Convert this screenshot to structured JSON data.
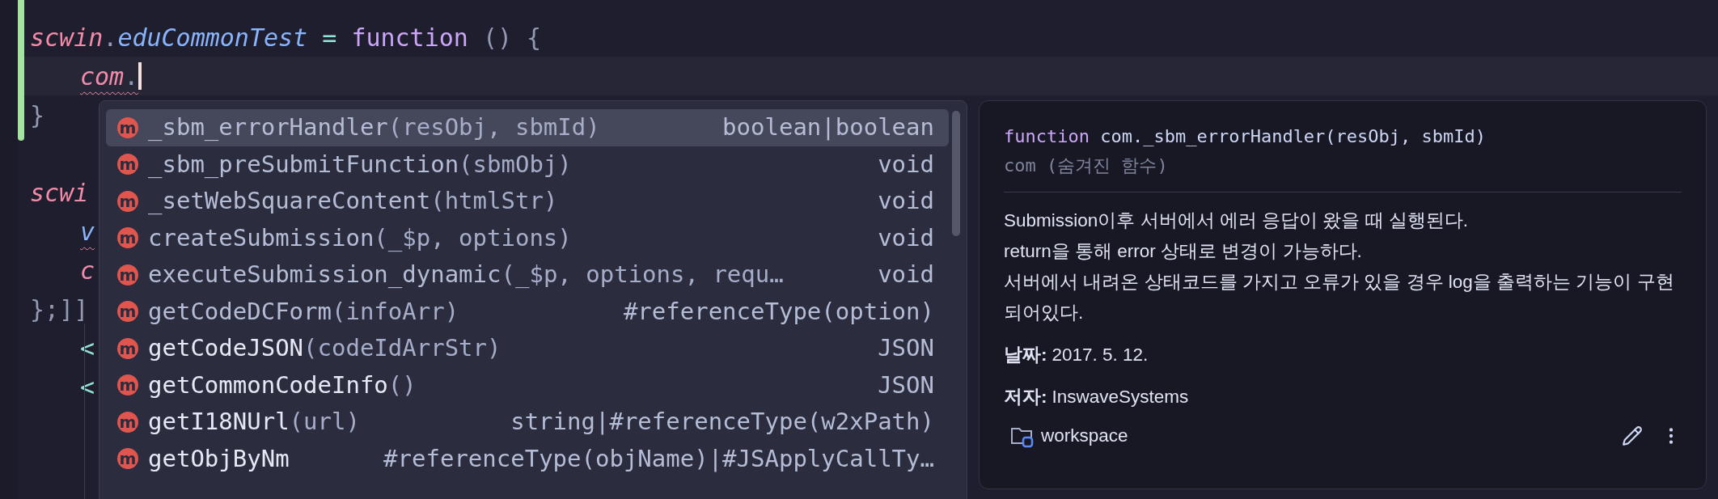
{
  "editor": {
    "lines": [
      {
        "tokens": [
          {
            "text": "scwin",
            "kind": "object"
          },
          {
            "text": ".",
            "kind": "punct"
          },
          {
            "text": "eduCommonTest",
            "kind": "property"
          },
          {
            "text": " = ",
            "kind": "operator"
          },
          {
            "text": "function",
            "kind": "keyword"
          },
          {
            "text": " () {",
            "kind": "punct"
          }
        ],
        "children": [
          {
            "current": true,
            "tokens": [
              {
                "text": "com",
                "kind": "object",
                "error": true
              },
              {
                "text": ".",
                "kind": "punct",
                "error": true
              }
            ]
          }
        ]
      },
      {
        "tokens": [
          {
            "text": "}",
            "kind": "punct"
          }
        ]
      },
      {
        "tokens": [
          {
            "text": "scwi",
            "kind": "object"
          }
        ],
        "children": [
          {
            "tokens": [
              {
                "text": "v",
                "kind": "property",
                "error": true
              }
            ]
          },
          {
            "tokens": [
              {
                "text": "c",
                "kind": "object"
              }
            ]
          }
        ]
      },
      {
        "tokens": [
          {
            "text": "};]]",
            "kind": "punct"
          }
        ],
        "children": [
          {
            "tokens": [
              {
                "text": "<",
                "kind": "tag"
              }
            ]
          },
          {
            "tokens": [
              {
                "text": "<",
                "kind": "tag"
              }
            ]
          }
        ]
      }
    ]
  },
  "completion": {
    "items": [
      {
        "badge": "m",
        "name": "_sbm_errorHandler",
        "params": "(resObj, sbmId)",
        "type": "boolean|boolean",
        "emphasized": false,
        "selected": true
      },
      {
        "badge": "m",
        "name": "_sbm_preSubmitFunction",
        "params": "(sbmObj)",
        "type": "void",
        "emphasized": false,
        "selected": false
      },
      {
        "badge": "m",
        "name": "_setWebSquareContent",
        "params": "(htmlStr)",
        "type": "void",
        "emphasized": false,
        "selected": false
      },
      {
        "badge": "m",
        "name": "createSubmission",
        "params": "(_$p, options)",
        "type": "void",
        "emphasized": false,
        "selected": false
      },
      {
        "badge": "m",
        "name": "executeSubmission_dynamic",
        "params": "(_$p, options, requ…",
        "type": "void",
        "emphasized": false,
        "selected": false
      },
      {
        "badge": "m",
        "name": "getCodeDCForm",
        "params": "(infoArr)",
        "type": "#referenceType(option)",
        "emphasized": false,
        "selected": false
      },
      {
        "badge": "m",
        "name": "getCodeJSON",
        "params": "(codeIdArrStr)",
        "type": "JSON",
        "emphasized": true,
        "selected": false
      },
      {
        "badge": "m",
        "name": "getCommonCodeInfo",
        "params": "()",
        "type": "JSON",
        "emphasized": true,
        "selected": false
      },
      {
        "badge": "m",
        "name": "getI18NUrl",
        "params": "(url)",
        "type": "string|#referenceType(w2xPath)",
        "emphasized": true,
        "selected": false
      },
      {
        "badge": "m",
        "name": "getObjByNm",
        "type": "#referenceType(objName)|#JSApplyCallTy…",
        "emphasized": true,
        "selected": false
      }
    ]
  },
  "documentation": {
    "signature_keyword": "function",
    "signature": "com._sbm_errorHandler(resObj, sbmId)",
    "container": "com (숨겨진 함수)",
    "description": [
      "Submission이후 서버에서 에러 응답이 왔을 때 실행된다.",
      "return을 통해 error 상태로 변경이 가능하다.",
      "서버에서 내려온 상태코드를 가지고 오류가 있을 경우 log을 출력하는 기능이 구현되어있다."
    ],
    "fields": [
      {
        "label": "날짜:",
        "value": "2017. 5. 12."
      },
      {
        "label": "저자:",
        "value": "InswaveSystems"
      }
    ],
    "location": "workspace"
  }
}
